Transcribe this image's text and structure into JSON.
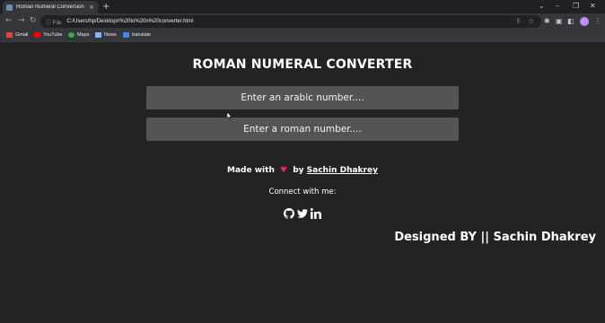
{
  "browser": {
    "tab_title": "Roman Numeral Conversion",
    "tab_close": "×",
    "new_tab": "+",
    "window_controls": {
      "dropdown": "⌄",
      "minimize": "–",
      "restore": "❐",
      "close": "✕"
    },
    "address_info": "ⓘ File",
    "url": "C:/Users/hp/Desktop/r%20to%20n%20converter.html",
    "bookmarks": [
      {
        "label": "Gmail",
        "icon": "gmail-icon",
        "color": "#ea4335"
      },
      {
        "label": "YouTube",
        "icon": "youtube-icon",
        "color": "#ff0000"
      },
      {
        "label": "Maps",
        "icon": "maps-icon",
        "color": "#34a853"
      },
      {
        "label": "News",
        "icon": "news-icon",
        "color": "#8ab4f8"
      },
      {
        "label": "translate",
        "icon": "translate-icon",
        "color": "#4285f4"
      }
    ]
  },
  "page": {
    "title": "ROMAN NUMERAL CONVERTER",
    "arabic_placeholder": "Enter an arabic number....",
    "roman_placeholder": "Enter a roman number....",
    "made_with": "Made with",
    "heart": "♥",
    "by": "by",
    "author": "Sachin Dhakrey",
    "connect": "Connect with me:",
    "social_icons": [
      "github-icon",
      "twitter-icon",
      "linkedin-icon"
    ],
    "designed_by": "Designed BY || Sachin Dhakrey"
  },
  "colors": {
    "page_background": "#232323",
    "input_background": "#545454",
    "heart": "#e0245e"
  }
}
